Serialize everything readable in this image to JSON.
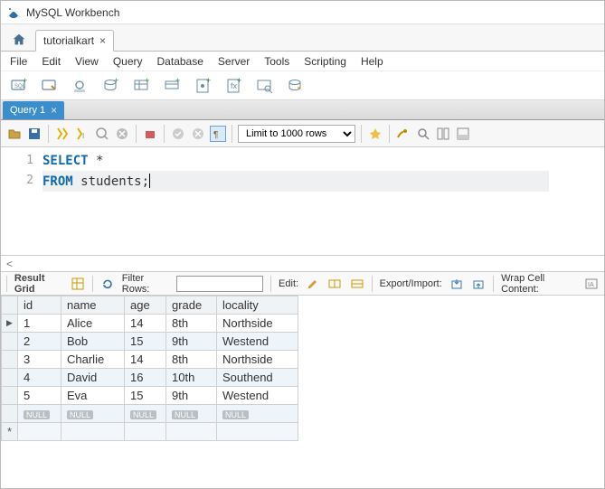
{
  "window": {
    "title": "MySQL Workbench"
  },
  "home_tab": {
    "doc_name": "tutorialkart"
  },
  "menu": [
    "File",
    "Edit",
    "View",
    "Query",
    "Database",
    "Server",
    "Tools",
    "Scripting",
    "Help"
  ],
  "editor": {
    "tab_label": "Query 1",
    "limit_label": "Limit to 1000 rows",
    "code": {
      "line_numbers": [
        "1",
        "2"
      ],
      "line1_kw": "SELECT",
      "line1_rest": " *",
      "line2_kw": "FROM",
      "line2_rest": " students;"
    }
  },
  "result_toolbar": {
    "label": "Result Grid",
    "filter_label": "Filter Rows:",
    "edit_label": "Edit:",
    "export_label": "Export/Import:",
    "wrap_label": "Wrap Cell Content:"
  },
  "grid": {
    "row_marker": "▶",
    "new_row_marker": "*",
    "columns": [
      "id",
      "name",
      "age",
      "grade",
      "locality"
    ],
    "rows": [
      {
        "id": "1",
        "name": "Alice",
        "age": "14",
        "grade": "8th",
        "locality": "Northside"
      },
      {
        "id": "2",
        "name": "Bob",
        "age": "15",
        "grade": "9th",
        "locality": "Westend"
      },
      {
        "id": "3",
        "name": "Charlie",
        "age": "14",
        "grade": "8th",
        "locality": "Northside"
      },
      {
        "id": "4",
        "name": "David",
        "age": "16",
        "grade": "10th",
        "locality": "Southend"
      },
      {
        "id": "5",
        "name": "Eva",
        "age": "15",
        "grade": "9th",
        "locality": "Westend"
      }
    ],
    "null_label": "NULL"
  }
}
